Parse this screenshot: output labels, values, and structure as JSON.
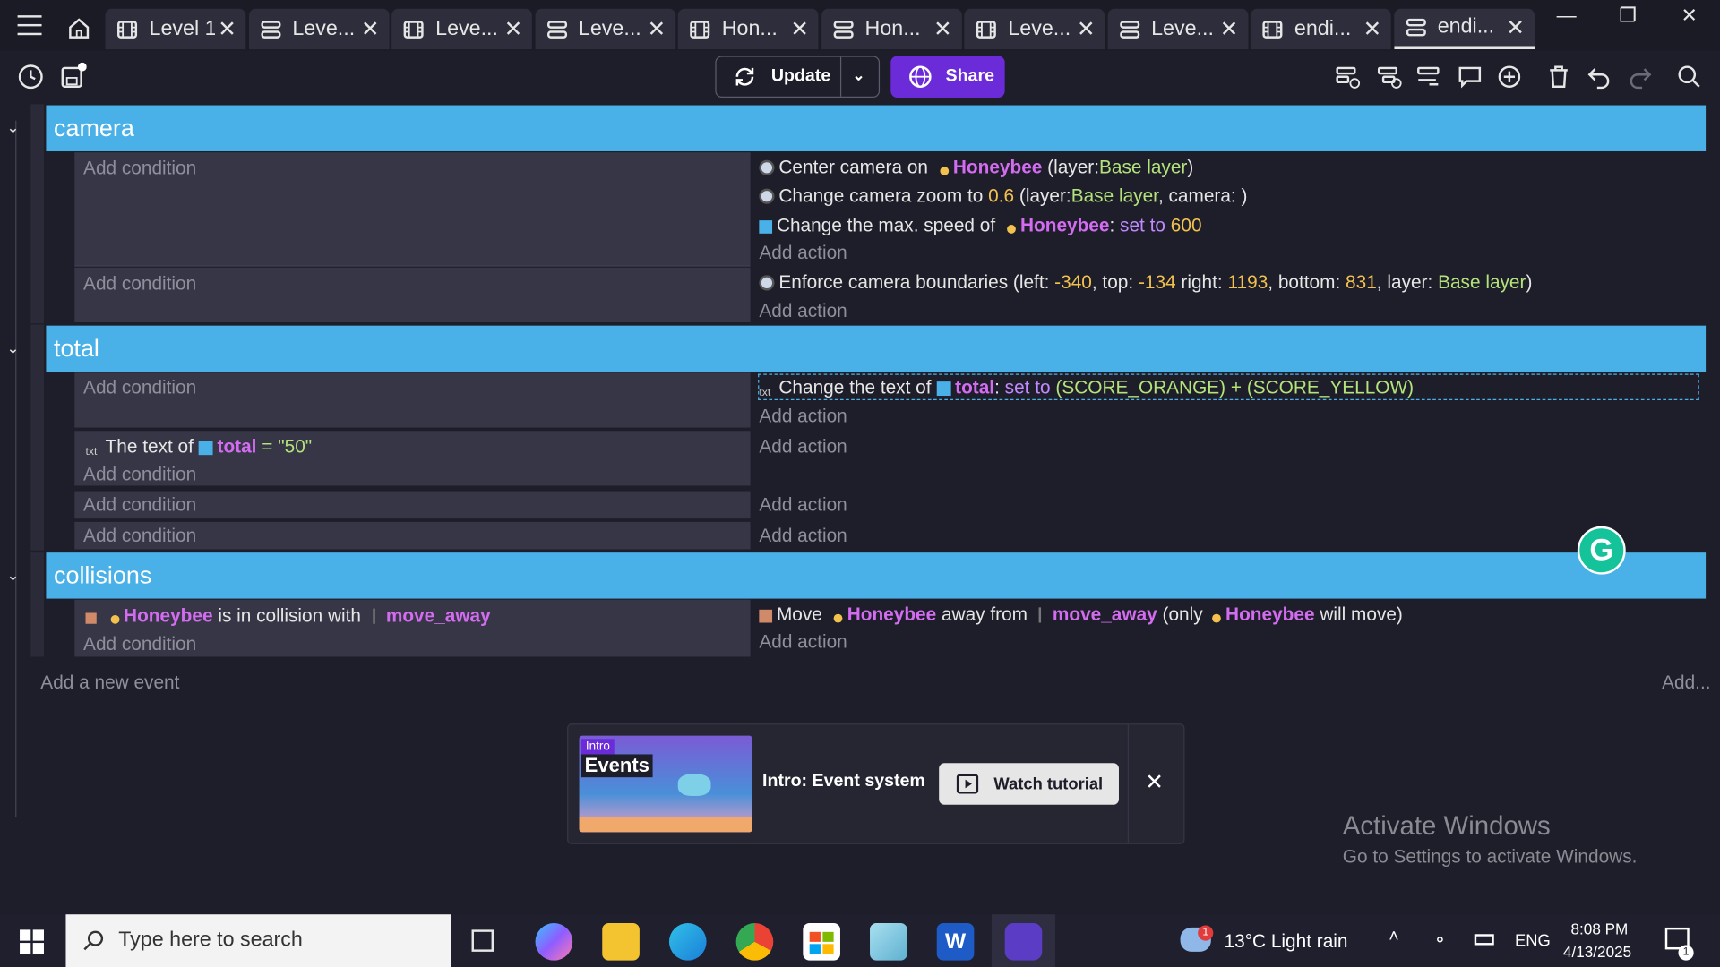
{
  "tabs": [
    {
      "label": "Level 1",
      "icon": "scene-icon"
    },
    {
      "label": "Leve...",
      "icon": "events-icon"
    },
    {
      "label": "Leve...",
      "icon": "scene-icon"
    },
    {
      "label": "Leve...",
      "icon": "events-icon"
    },
    {
      "label": "Hon...",
      "icon": "scene-icon"
    },
    {
      "label": "Hon...",
      "icon": "events-icon"
    },
    {
      "label": "Leve...",
      "icon": "scene-icon"
    },
    {
      "label": "Leve...",
      "icon": "events-icon"
    },
    {
      "label": "endi...",
      "icon": "scene-icon"
    },
    {
      "label": "endi...",
      "icon": "events-icon",
      "active": true
    }
  ],
  "toolbar": {
    "update_label": "Update",
    "share_label": "Share"
  },
  "groups": [
    {
      "title": "camera"
    },
    {
      "title": "total"
    },
    {
      "title": "collisions"
    }
  ],
  "camera": {
    "row1": {
      "cond": "Add condition",
      "a1": {
        "p1": "Center camera on",
        "obj": "Honeybee",
        "p2": "(layer:",
        "layer": "Base layer",
        "p3": ")"
      },
      "a2": {
        "p1": "Change camera zoom to",
        "zoom": "0.6",
        "p2": "(layer:",
        "layer": "Base layer",
        "p3": ", camera: )"
      },
      "a3": {
        "p1": "Change the max. speed of",
        "obj": "Honeybee",
        "colon": ":",
        "setto": "set to",
        "val": "600"
      },
      "add": "Add action"
    },
    "row2": {
      "cond": "Add condition",
      "a1": {
        "p1": "Enforce camera boundaries (left:",
        "left": "-340",
        "p2": ", top:",
        "top": "-134",
        "p3": "right:",
        "right": "1193",
        "p4": ", bottom:",
        "bottom": "831",
        "p5": ", layer:",
        "layer": "Base layer",
        "p6": ")"
      },
      "add": "Add action"
    }
  },
  "total": {
    "row1": {
      "cond": "Add condition",
      "a1": {
        "p1": "Change the text of",
        "obj": "total",
        "colon": ":",
        "setto": "set to",
        "expr": "(SCORE_ORANGE) + (SCORE_YELLOW)"
      },
      "add": "Add action"
    },
    "row2": {
      "c1": {
        "p1": "The text of",
        "obj": "total",
        "eq": "=",
        "val": "\"50\""
      },
      "cond": "Add condition",
      "add": "Add action"
    },
    "row3": {
      "cond": "Add condition",
      "add": "Add action"
    },
    "row4": {
      "cond": "Add condition",
      "add": "Add action"
    }
  },
  "collisions": {
    "row1": {
      "c1": {
        "obj": "Honeybee",
        "p1": "is in collision with",
        "obj2": "move_away"
      },
      "cond": "Add condition",
      "a1": {
        "p1": "Move",
        "obj": "Honeybee",
        "p2": "away from",
        "obj2": "move_away",
        "p3": "(only",
        "obj3": "Honeybee",
        "p4": "will move)"
      },
      "add": "Add action"
    }
  },
  "footer": {
    "add_event": "Add a new event",
    "add_more": "Add..."
  },
  "tutorial": {
    "thumb_tag": "Intro",
    "thumb_title": "Events",
    "title": "Intro: Event system",
    "button": "Watch tutorial"
  },
  "watermark": {
    "line1": "Activate Windows",
    "line2": "Go to Settings to activate Windows."
  },
  "taskbar": {
    "search_placeholder": "Type here to search",
    "weather": "13°C  Light rain",
    "weather_badge": "1",
    "lang": "ENG",
    "time": "8:08 PM",
    "date": "4/13/2025",
    "notif": "1"
  }
}
